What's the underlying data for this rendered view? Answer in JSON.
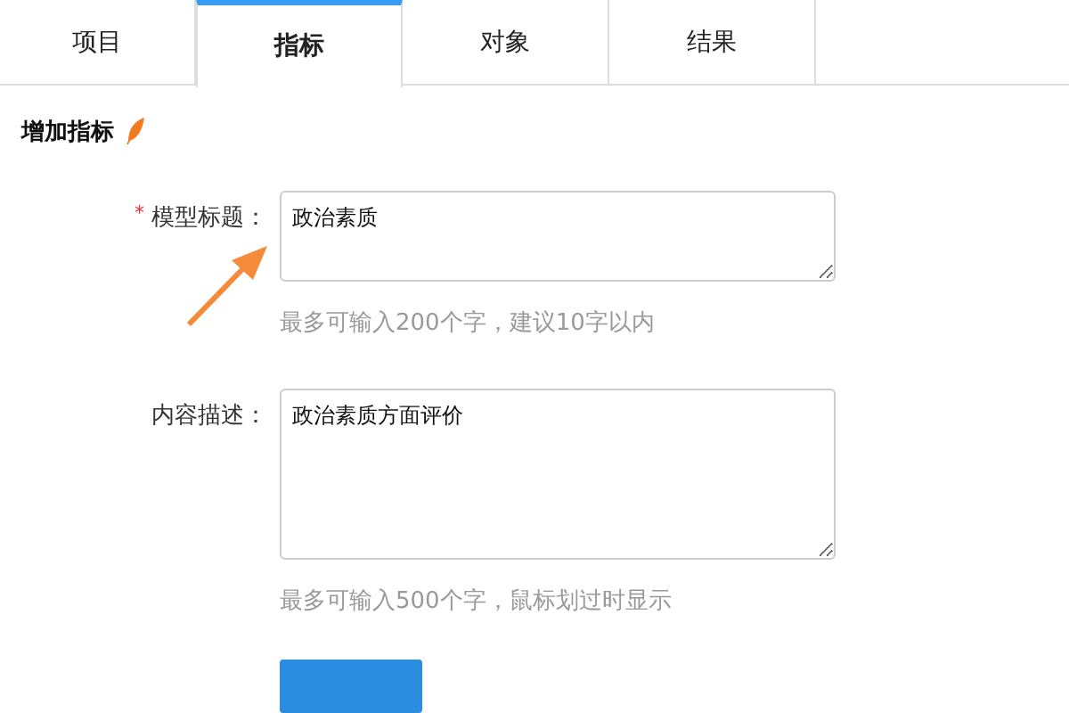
{
  "tabs": [
    {
      "label": "项目",
      "selected": false
    },
    {
      "label": "指标",
      "selected": true
    },
    {
      "label": "对象",
      "selected": false
    },
    {
      "label": "结果",
      "selected": false
    }
  ],
  "section": {
    "title": "增加指标"
  },
  "fields": [
    {
      "label": "模型标题：",
      "required": true,
      "value": "政治素质",
      "hint": "最多可输入200个字，建议10字以内",
      "kind": "short"
    },
    {
      "label": "内容描述：",
      "required": false,
      "value": "政治素质方面评价",
      "hint": "最多可输入500个字，鼠标划过时显示",
      "kind": "long"
    }
  ],
  "required_mark": "*"
}
